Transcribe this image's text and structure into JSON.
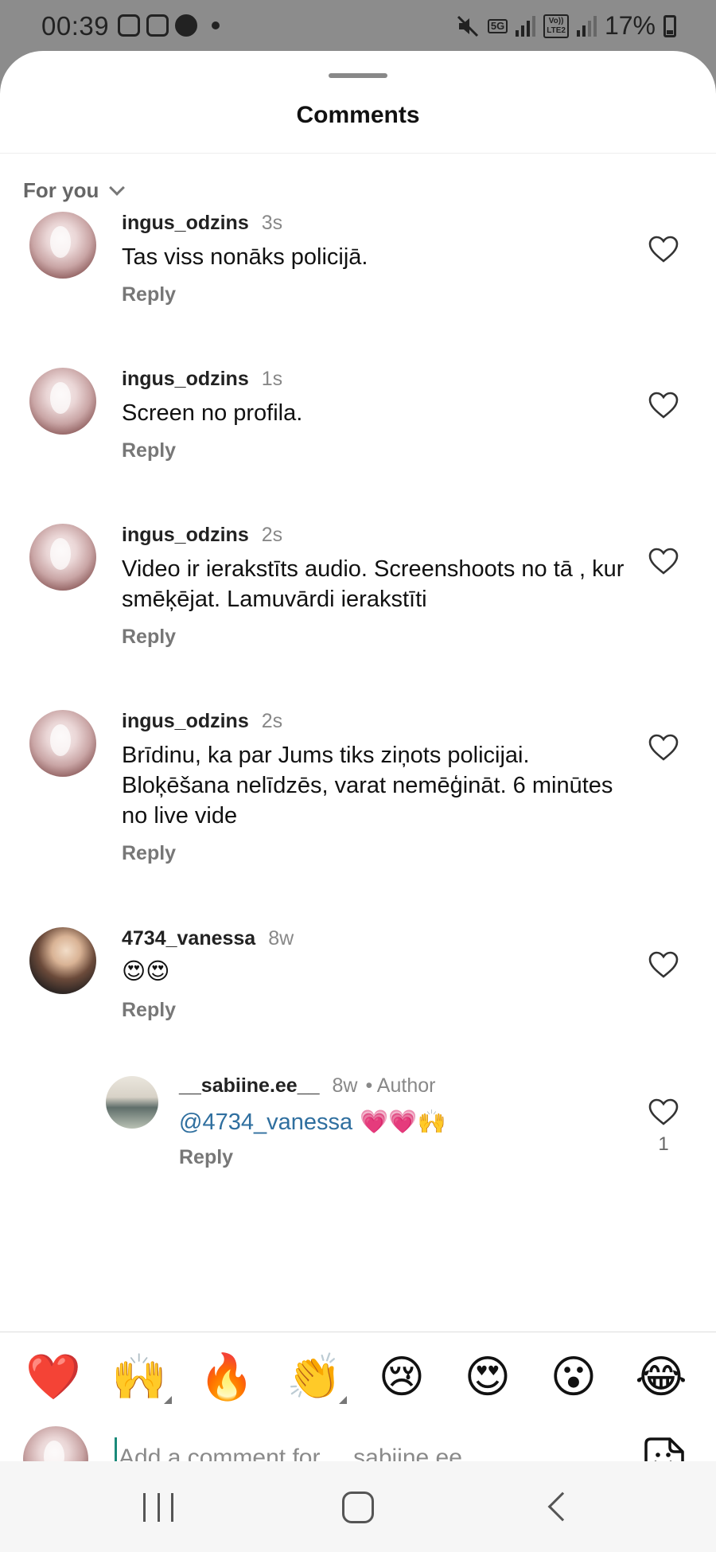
{
  "status_bar": {
    "time": "00:39",
    "network_label": "5G",
    "volte_label": "Vo))\nLTE2",
    "battery": "17%"
  },
  "sheet": {
    "title": "Comments",
    "filter_label": "For you"
  },
  "comments": [
    {
      "username": "ingus_odzins",
      "time": "3s",
      "text": "Tas viss nonāks policijā.",
      "reply": "Reply"
    },
    {
      "username": "ingus_odzins",
      "time": "1s",
      "text": "Screen no profila.",
      "reply": "Reply"
    },
    {
      "username": "ingus_odzins",
      "time": "2s",
      "text": "Video ir  ierakstīts audio. Screenshoots no tā , kur smēķējat. Lamuvārdi ierakstīti",
      "reply": "Reply"
    },
    {
      "username": "ingus_odzins",
      "time": "2s",
      "text": "Brīdinu, ka par Jums tiks ziņots policijai. Bloķēšana nelīdzēs, varat nemēģināt. 6 minūtes no live vide",
      "reply": "Reply"
    },
    {
      "username": "4734_vanessa",
      "time": "8w",
      "text": "😍😍",
      "reply": "Reply"
    }
  ],
  "reply_comment": {
    "username": "__sabiine.ee__",
    "time": "8w",
    "author_tag": "• Author",
    "mention": "@4734_vanessa",
    "text": " 💗💗🙌",
    "reply": "Reply",
    "likes": "1"
  },
  "quick_emojis": [
    "❤️",
    "🙌",
    "🔥",
    "👏",
    "😢",
    "😍",
    "😮",
    "😂"
  ],
  "composer": {
    "placeholder": "Add a comment for __sabiine.ee__..."
  },
  "colors": {
    "mention": "#2f6f9f",
    "cursor": "#1a8a7a",
    "status_bar_bg": "#8c8c8c"
  },
  "icons": {
    "like": "heart-outline-icon",
    "sticker": "sticker-icon",
    "filter": "chevron-down-icon"
  }
}
